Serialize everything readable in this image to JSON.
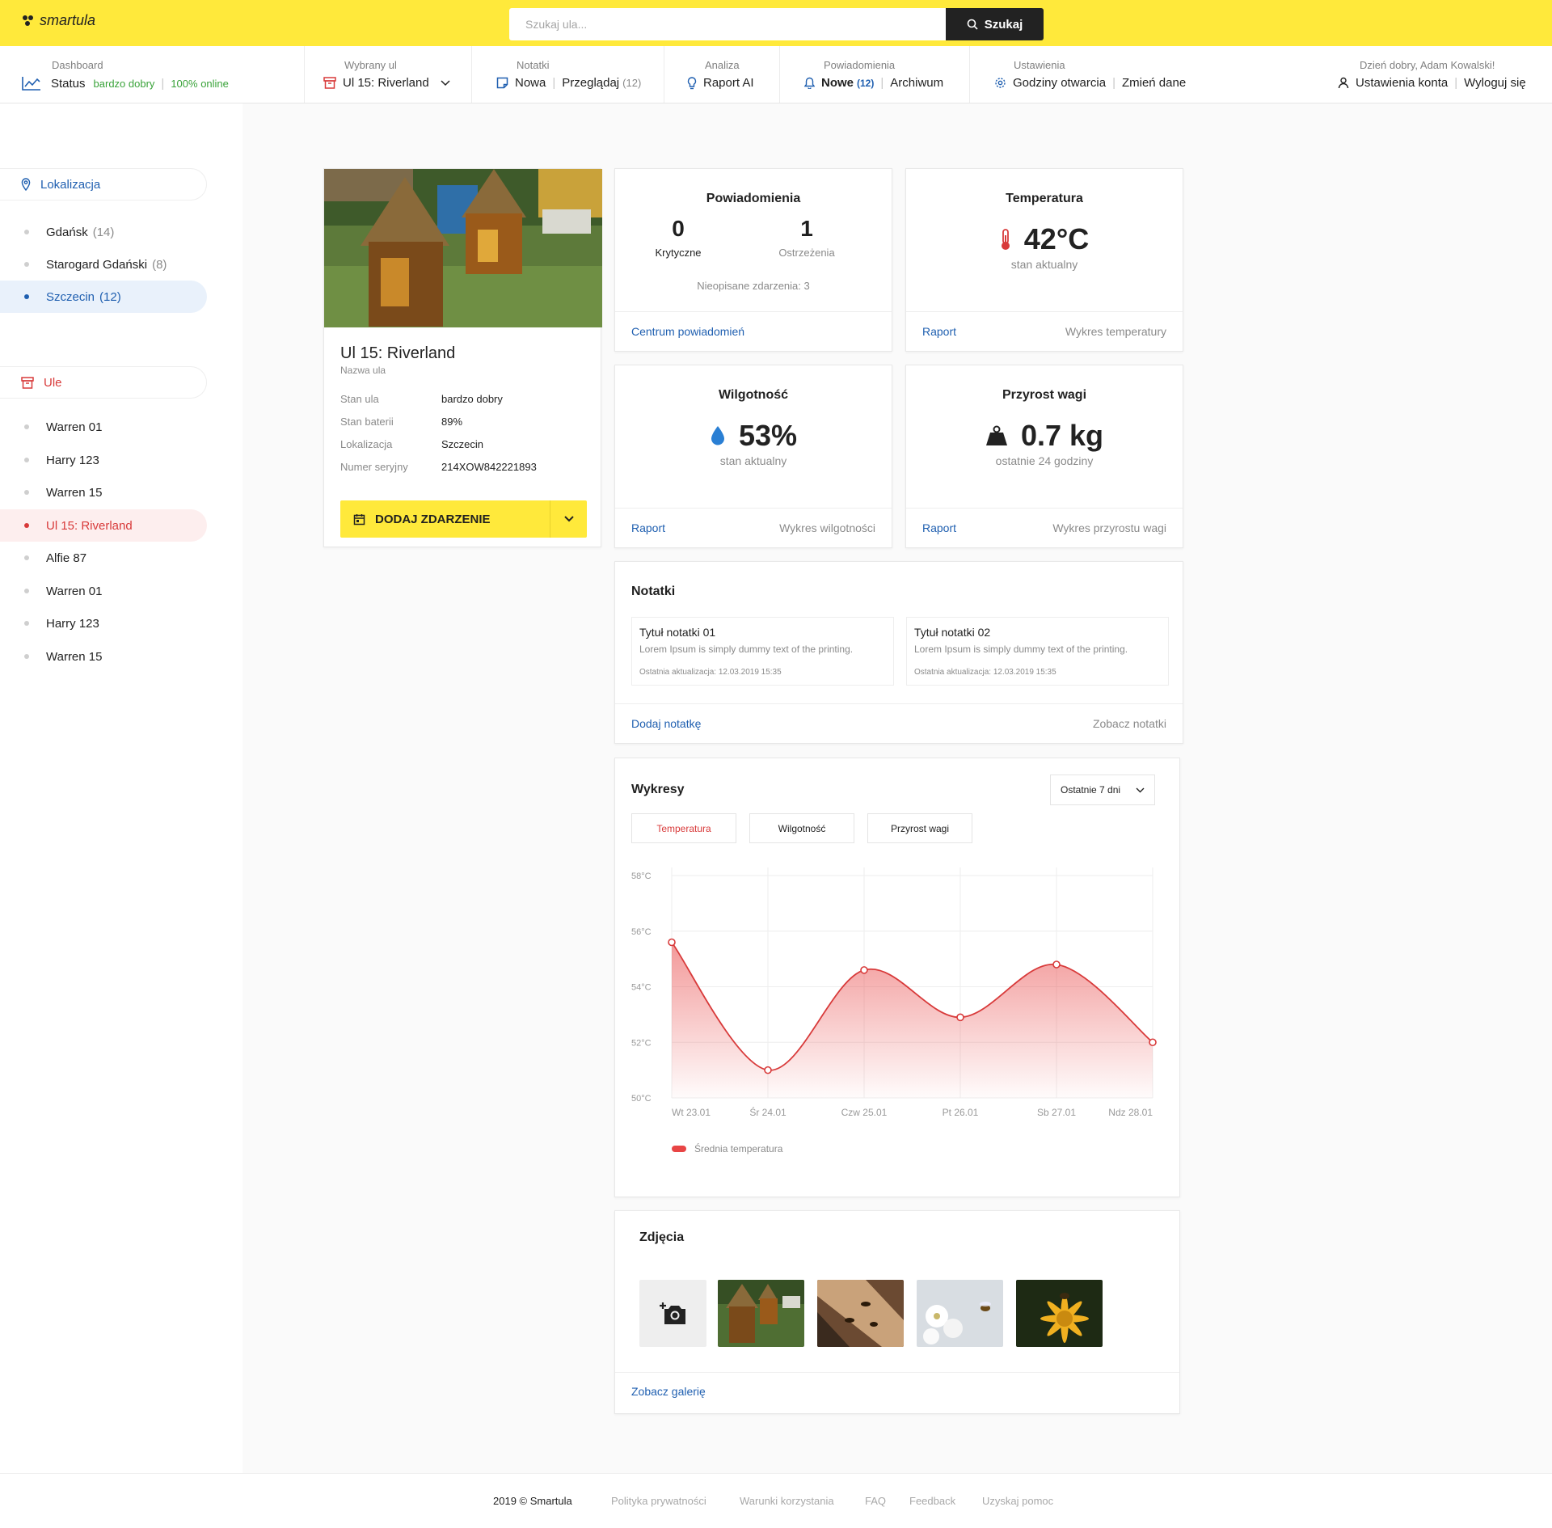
{
  "app": {
    "name": "smartula"
  },
  "search": {
    "placeholder": "Szukaj ula...",
    "button": "Szukaj"
  },
  "nav": {
    "dashboard": {
      "caption": "Dashboard",
      "label": "Status",
      "state": "bardzo dobry",
      "online": "100% online"
    },
    "hive": {
      "caption": "Wybrany ul",
      "value": "Ul 15: Riverland"
    },
    "notes": {
      "caption": "Notatki",
      "new": "Nowa",
      "browse": "Przeglądaj",
      "count": "(12)"
    },
    "analysis": {
      "caption": "Analiza",
      "report": "Raport AI"
    },
    "notifications": {
      "caption": "Powiadomienia",
      "new": "Nowe",
      "count": "(12)",
      "archive": "Archiwum"
    },
    "settings": {
      "caption": "Ustawienia",
      "hours": "Godziny otwarcia",
      "change": "Zmień dane"
    },
    "user": {
      "greeting": "Dzień dobry, Adam Kowalski!",
      "account": "Ustawienia konta",
      "logout": "Wyloguj się"
    }
  },
  "sidebar": {
    "locations_title": "Lokalizacja",
    "locations": [
      {
        "name": "Gdańsk",
        "count": "(14)"
      },
      {
        "name": "Starogard Gdański",
        "count": "(8)"
      },
      {
        "name": "Szczecin",
        "count": "(12)"
      }
    ],
    "hives_title": "Ule",
    "hives": [
      "Warren 01",
      "Harry 123",
      "Warren 15",
      "Ul 15: Riverland",
      "Alfie 87",
      "Warren 01",
      "Harry 123",
      "Warren 15"
    ]
  },
  "hive": {
    "name": "Ul 15: Riverland",
    "name_caption": "Nazwa ula",
    "fields": [
      {
        "label": "Stan ula",
        "value": "bardzo dobry"
      },
      {
        "label": "Stan baterii",
        "value": "89%"
      },
      {
        "label": "Lokalizacja",
        "value": "Szczecin"
      },
      {
        "label": "Numer seryjny",
        "value": "214XOW842221893"
      }
    ],
    "add_event": "DODAJ ZDARZENIE"
  },
  "notifications_card": {
    "title": "Powiadomienia",
    "critical_value": "0",
    "critical_label": "Krytyczne",
    "warnings_value": "1",
    "warnings_label": "Ostrzeżenia",
    "undescribed": "Nieopisane zdarzenia: 3",
    "link": "Centrum powiadomień"
  },
  "temperature_card": {
    "title": "Temperatura",
    "value": "42°C",
    "caption": "stan aktualny",
    "link_left": "Raport",
    "link_right": "Wykres temperatury"
  },
  "humidity_card": {
    "title": "Wilgotność",
    "value": "53%",
    "caption": "stan aktualny",
    "link_left": "Raport",
    "link_right": "Wykres wilgotności"
  },
  "weight_card": {
    "title": "Przyrost wagi",
    "value": "0.7 kg",
    "caption": "ostatnie 24 godziny",
    "link_left": "Raport",
    "link_right": "Wykres przyrostu wagi"
  },
  "notes_card": {
    "title": "Notatki",
    "items": [
      {
        "title": "Tytuł notatki 01",
        "text": "Lorem Ipsum is simply dummy text of the printing.",
        "updated": "Ostatnia aktualizacja: 12.03.2019 15:35"
      },
      {
        "title": "Tytuł notatki 02",
        "text": "Lorem Ipsum is simply dummy text of the printing.",
        "updated": "Ostatnia aktualizacja: 12.03.2019 15:35"
      }
    ],
    "add": "Dodaj notatkę",
    "view": "Zobacz notatki"
  },
  "charts_card": {
    "title": "Wykresy",
    "range": "Ostatnie 7 dni",
    "tabs": [
      "Temperatura",
      "Wilgotność",
      "Przyrost wagi"
    ],
    "active_tab": "Temperatura"
  },
  "chart_data": {
    "type": "area",
    "x": [
      "Wt 23.01",
      "Śr 24.01",
      "Czw 25.01",
      "Pt 26.01",
      "Sb 27.01",
      "Ndz 28.01"
    ],
    "series": [
      {
        "name": "Średnia temperatura",
        "values": [
          55.6,
          51.0,
          54.6,
          52.9,
          54.8,
          52.0
        ],
        "color": "#d83a3a"
      }
    ],
    "yticks": [
      "58°C",
      "56°C",
      "54°C",
      "52°C",
      "50°C"
    ],
    "ylim": [
      50,
      58
    ],
    "grid": true,
    "legend": "bottom-left"
  },
  "photos_card": {
    "title": "Zdjęcia",
    "gallery": "Zobacz galerię"
  },
  "footer": {
    "copyright": "2019 © Smartula",
    "links": [
      "Polityka prywatności",
      "Warunki korzystania",
      "FAQ",
      "Feedback",
      "Uzyskaj pomoc"
    ]
  },
  "colors": {
    "brand": "#ffe93b",
    "dark": "#222222",
    "link": "#1f5fb0",
    "good": "#3aa33a",
    "alert": "#d83a3a"
  }
}
